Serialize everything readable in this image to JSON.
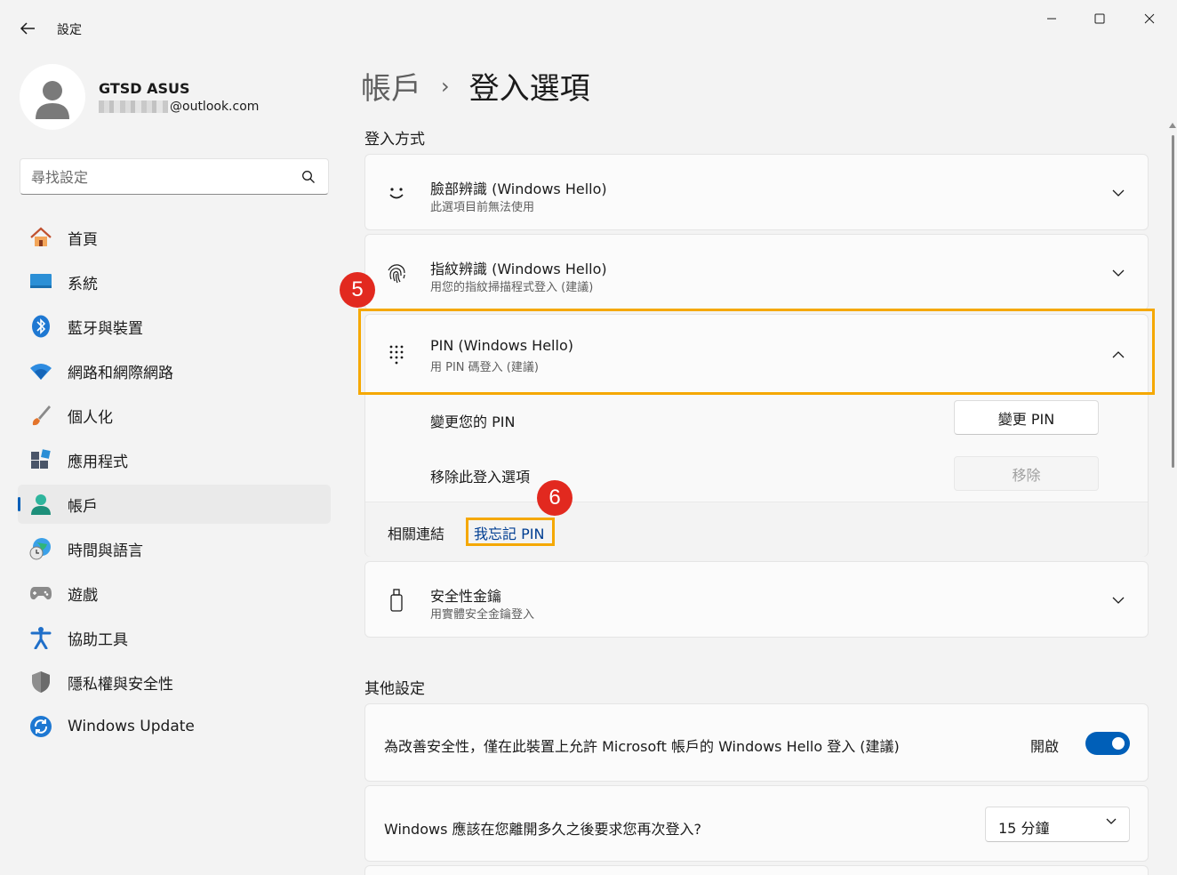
{
  "window": {
    "title": "設定"
  },
  "user": {
    "name": "GTSD ASUS",
    "email": "@outlook.com"
  },
  "search": {
    "placeholder": "尋找設定"
  },
  "nav": [
    {
      "label": "首頁",
      "icon": "home-icon"
    },
    {
      "label": "系統",
      "icon": "system-icon"
    },
    {
      "label": "藍牙與裝置",
      "icon": "bluetooth-icon"
    },
    {
      "label": "網路和網際網路",
      "icon": "wifi-icon"
    },
    {
      "label": "個人化",
      "icon": "brush-icon"
    },
    {
      "label": "應用程式",
      "icon": "apps-icon"
    },
    {
      "label": "帳戶",
      "icon": "account-icon",
      "active": true
    },
    {
      "label": "時間與語言",
      "icon": "globe-clock-icon"
    },
    {
      "label": "遊戲",
      "icon": "gamepad-icon"
    },
    {
      "label": "協助工具",
      "icon": "accessibility-icon"
    },
    {
      "label": "隱私權與安全性",
      "icon": "shield-icon"
    },
    {
      "label": "Windows Update",
      "icon": "update-icon"
    }
  ],
  "breadcrumb": {
    "parent": "帳戶",
    "separator": "›",
    "current": "登入選項"
  },
  "signin_methods": {
    "title": "登入方式",
    "face": {
      "title": "臉部辨識 (Windows Hello)",
      "subtitle": "此選項目前無法使用",
      "icon": "smiley-icon"
    },
    "fingerprint": {
      "title": "指紋辨識 (Windows Hello)",
      "subtitle": "用您的指紋掃描程式登入 (建議)",
      "icon": "fingerprint-icon"
    },
    "pin": {
      "title": "PIN (Windows Hello)",
      "subtitle": "用 PIN 碼登入 (建議)",
      "icon": "keypad-icon",
      "change_label": "變更您的 PIN",
      "change_button": "變更 PIN",
      "remove_label": "移除此登入選項",
      "remove_button": "移除",
      "related_label": "相關連結",
      "forgot_link": "我忘記 PIN"
    },
    "security_key": {
      "title": "安全性金鑰",
      "subtitle": "用實體安全金鑰登入",
      "icon": "usb-key-icon"
    }
  },
  "other_settings": {
    "title": "其他設定",
    "hello_only": {
      "label": "為改善安全性，僅在此裝置上允許 Microsoft 帳戶的 Windows Hello 登入 (建議)",
      "state": "開啟",
      "on": true
    },
    "require_signin": {
      "label": "Windows 應該在您離開多久之後要求您再次登入?",
      "value": "15 分鐘"
    }
  },
  "annotations": {
    "step5": "5",
    "step6": "6",
    "highlight_color": "#f5a800",
    "badge_color": "#e2291f"
  },
  "colors": {
    "accent": "#005fb8",
    "link": "#003e92"
  }
}
